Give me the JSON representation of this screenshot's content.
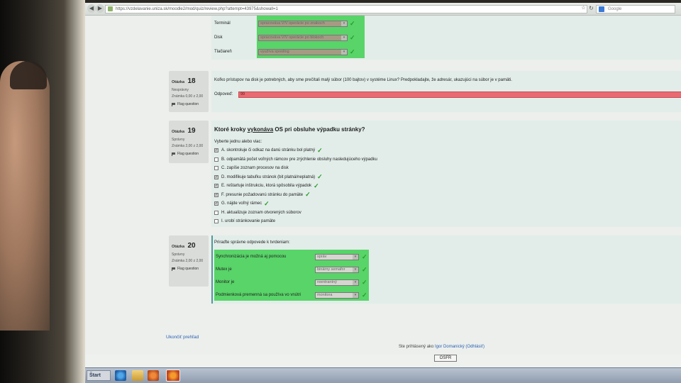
{
  "browser": {
    "url": "https://vzdelavanie.uniza.sk/moodle2/mod/quiz/review.php?attempt=43975&showall=1",
    "search_placeholder": "Google",
    "icons": [
      "back-icon",
      "forward-icon",
      "lock-icon",
      "star-icon",
      "reload-icon",
      "google-icon"
    ]
  },
  "q17_partial": {
    "rows": [
      {
        "label": "Terminál",
        "value": "spracováva V/V operácie po znakoch"
      },
      {
        "label": "Disk",
        "value": "spracováva V/V operácie po blokoch"
      },
      {
        "label": "Tlačiareň",
        "value": "využíva spooling"
      }
    ]
  },
  "q18": {
    "label": "Otázka",
    "number": "18",
    "status": "Nesprávny",
    "grade": "Známka 0,00 z 2,00",
    "flag": "Flag question",
    "text": "Koľko prístupov na disk je potrebných, aby sme prečítali malý súbor (100 bajtov) v systéme Linux? Predpokladajte, že adresár, ukazujúci na súbor je v pamäti.",
    "answer_label": "Odpoveď:",
    "answer_value": "99"
  },
  "q19": {
    "label": "Otázka",
    "number": "19",
    "status": "Správny",
    "grade": "Známka 2,00 z 2,00",
    "flag": "Flag question",
    "title_before": "Ktoré kroky ",
    "title_underlined": "vykonáva",
    "title_after": " OS pri obsluhe výpadku stránky?",
    "instruction": "Vyberte jednu alebo viac:",
    "options": [
      {
        "text": "A. skontroluje či odkaz na danú stránku bol platný",
        "checked": true,
        "correct": true
      },
      {
        "text": "B. odpamätá počet voľných rámcov pre zrýchlenie obsluhy nasledujúceho výpadku",
        "checked": false,
        "correct": false
      },
      {
        "text": "C. zapíše zoznam procesov na disk",
        "checked": false,
        "correct": false
      },
      {
        "text": "D. modifikuje tabuľku stránok (bit platná/neplatná)",
        "checked": true,
        "correct": true
      },
      {
        "text": "E. reštartuje inštrukciu, ktorá spôsobila výpadok",
        "checked": true,
        "correct": true
      },
      {
        "text": "F. presunie požadovanú stránku do pamäte",
        "checked": true,
        "correct": true
      },
      {
        "text": "G. nájde voľný rámec",
        "checked": true,
        "correct": true
      },
      {
        "text": "H. aktualizuje zoznam otvorených súborov",
        "checked": false,
        "correct": false
      },
      {
        "text": "I. urobí stránkovanie pamäte",
        "checked": false,
        "correct": false
      }
    ]
  },
  "q20": {
    "label": "Otázka",
    "number": "20",
    "status": "Správny",
    "grade": "Známka 2,00 z 2,00",
    "flag": "Flag question",
    "text": "Priraďte správne odpovede k tvrdeniam:",
    "rows": [
      {
        "label": "Synchronizácia je možná aj pomocou",
        "value": "správ"
      },
      {
        "label": "Mutex je",
        "value": "binárny semafor"
      },
      {
        "label": "Monitor je",
        "value": "reentrantný"
      },
      {
        "label": "Podmienková premenná sa používa vo vnútri",
        "value": "monitora"
      }
    ]
  },
  "footer": {
    "finish_review": "Ukončiť prehľad",
    "logged_in_prefix": "Ste prihlásený ako",
    "user_name": "Igor Domanický",
    "logout": "(Odhlásiť)",
    "course_button": "OSFR"
  },
  "taskbar": {
    "start_label": "Štart",
    "icons": [
      "ie-icon",
      "folder-icon",
      "media-player-icon",
      "firefox-icon"
    ]
  },
  "colors": {
    "correct_green": "#58d468",
    "wrong_red": "#e86b72",
    "page_bg": "#ecefec"
  }
}
